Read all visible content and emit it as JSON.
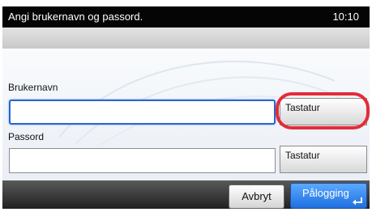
{
  "header": {
    "title": "Angi brukernavn og passord.",
    "time": "10:10"
  },
  "form": {
    "username_label": "Brukernavn",
    "username_value": "",
    "password_label": "Passord",
    "password_value": "",
    "keyboard_button_label": "Tastatur"
  },
  "footer": {
    "cancel_label": "Avbryt",
    "login_label": "Pålogging"
  },
  "colors": {
    "highlight": "#e32b3a",
    "login_button": "#2f86f0",
    "focus": "#2b67c9"
  },
  "icons": {
    "enter": "enter-icon"
  }
}
